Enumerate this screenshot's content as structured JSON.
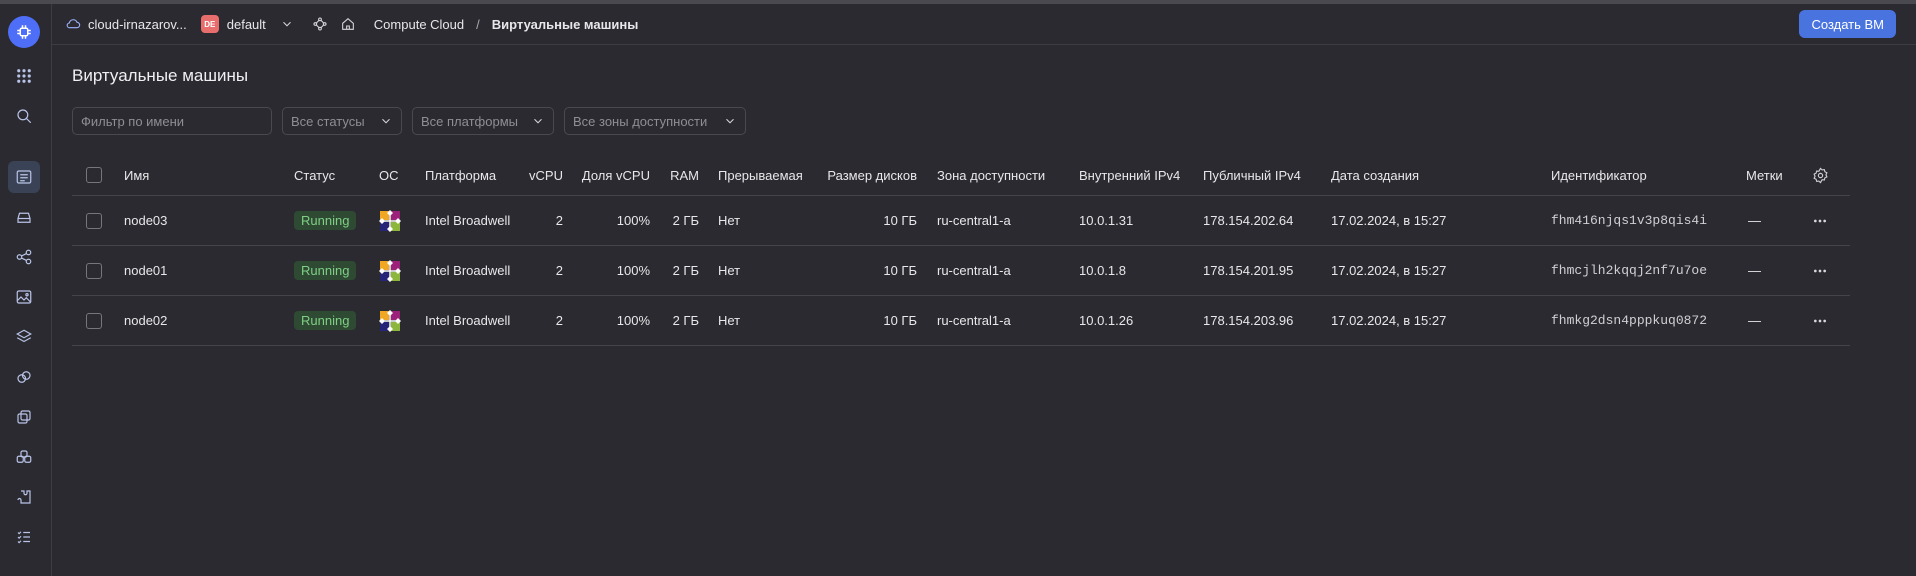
{
  "header": {
    "cloud_name": "cloud-irnazarov...",
    "folder_badge": "DE",
    "folder_name": "default",
    "breadcrumb_service": "Compute Cloud",
    "breadcrumb_sep": "/",
    "breadcrumb_current": "Виртуальные машины",
    "create_button": "Создать ВМ"
  },
  "page": {
    "title": "Виртуальные машины"
  },
  "filters": {
    "name_placeholder": "Фильтр по имени",
    "status": "Все статусы",
    "platform": "Все платформы",
    "zone": "Все зоны доступности"
  },
  "table": {
    "columns": {
      "name": "Имя",
      "status": "Статус",
      "os": "ОС",
      "platform": "Платформа",
      "vcpu": "vCPU",
      "vcpu_share": "Доля vCPU",
      "ram": "RAM",
      "preemptible": "Прерываемая",
      "disk": "Размер дисков",
      "zone": "Зона доступности",
      "ip_internal": "Внутренний IPv4",
      "ip_public": "Публичный IPv4",
      "created": "Дата создания",
      "id": "Идентификатор",
      "labels": "Метки"
    },
    "rows": [
      {
        "name": "node03",
        "status": "Running",
        "platform": "Intel Broadwell",
        "vcpu": "2",
        "vcpu_share": "100%",
        "ram": "2 ГБ",
        "preemptible": "Нет",
        "disk": "10 ГБ",
        "zone": "ru-central1-a",
        "ip_internal": "10.0.1.31",
        "ip_public": "178.154.202.64",
        "created": "17.02.2024, в 15:27",
        "id": "fhm416njqs1v3p8qis4i",
        "labels": "—"
      },
      {
        "name": "node01",
        "status": "Running",
        "platform": "Intel Broadwell",
        "vcpu": "2",
        "vcpu_share": "100%",
        "ram": "2 ГБ",
        "preemptible": "Нет",
        "disk": "10 ГБ",
        "zone": "ru-central1-a",
        "ip_internal": "10.0.1.8",
        "ip_public": "178.154.201.95",
        "created": "17.02.2024, в 15:27",
        "id": "fhmcjlh2kqqj2nf7u7oe",
        "labels": "—"
      },
      {
        "name": "node02",
        "status": "Running",
        "platform": "Intel Broadwell",
        "vcpu": "2",
        "vcpu_share": "100%",
        "ram": "2 ГБ",
        "preemptible": "Нет",
        "disk": "10 ГБ",
        "zone": "ru-central1-a",
        "ip_internal": "10.0.1.26",
        "ip_public": "178.154.203.96",
        "created": "17.02.2024, в 15:27",
        "id": "fhmkg2dsn4pppkuq0872",
        "labels": "—"
      }
    ]
  },
  "colors": {
    "accent": "#4974e0",
    "status_running_bg": "#2f4a33",
    "status_running_text": "#7fcf85"
  }
}
